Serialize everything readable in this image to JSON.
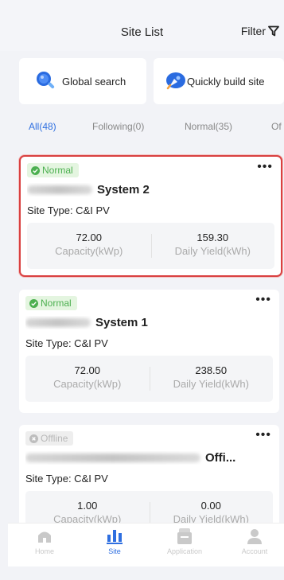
{
  "header": {
    "title": "Site List",
    "filter_label": "Filter"
  },
  "quick_actions": [
    {
      "label": "Global search",
      "icon": "search-icon"
    },
    {
      "label": "Quickly build site",
      "icon": "rocket-icon"
    }
  ],
  "tabs": [
    {
      "label": "All(48)",
      "active": true
    },
    {
      "label": "Following(0)",
      "active": false
    },
    {
      "label": "Normal(35)",
      "active": false
    },
    {
      "label": "Of",
      "active": false
    }
  ],
  "sites": [
    {
      "status": "Normal",
      "name_suffix": "System 2",
      "type": "Site Type: C&I PV",
      "capacity_value": "72.00",
      "capacity_label": "Capacity(kWp)",
      "yield_value": "159.30",
      "yield_label": "Daily Yield(kWh)",
      "highlighted": true
    },
    {
      "status": "Normal",
      "name_suffix": "System 1",
      "type": "Site Type: C&I PV",
      "capacity_value": "72.00",
      "capacity_label": "Capacity(kWp)",
      "yield_value": "238.50",
      "yield_label": "Daily Yield(kWh)",
      "highlighted": false
    },
    {
      "status": "Offline",
      "name_suffix": "Offi...",
      "type": "Site Type: C&I PV",
      "capacity_value": "1.00",
      "capacity_label": "Capacity(kWp)",
      "yield_value": "0.00",
      "yield_label": "Daily Yield(kWh)",
      "highlighted": false
    }
  ],
  "more_label": "•••",
  "nav": [
    {
      "label": "Home",
      "icon": "home-icon",
      "active": false
    },
    {
      "label": "Site",
      "icon": "site-chart-icon",
      "active": true
    },
    {
      "label": "Application",
      "icon": "application-icon",
      "active": false
    },
    {
      "label": "Account",
      "icon": "account-icon",
      "active": false
    }
  ],
  "colors": {
    "accent": "#2f6fe0",
    "normal": "#4cb050",
    "offline": "#b9b9b9",
    "highlight_border": "#d94040"
  }
}
